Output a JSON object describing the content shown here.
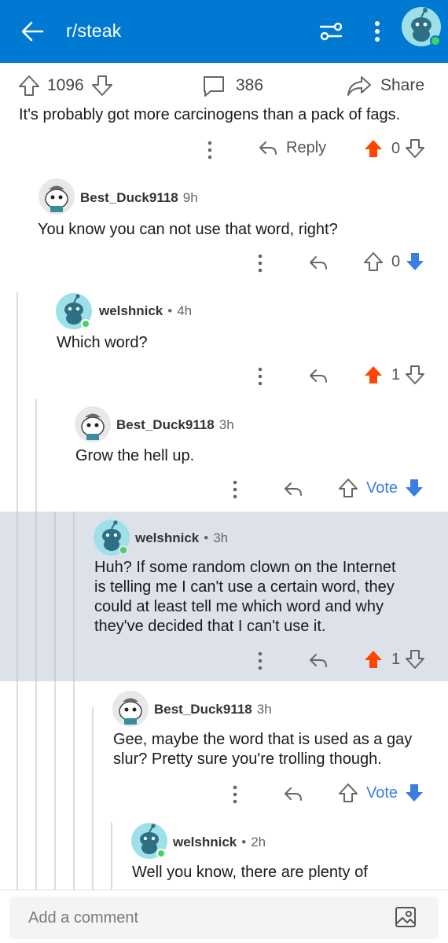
{
  "header": {
    "title": "r/steak",
    "back_icon": "back-arrow-icon",
    "sort_icon": "sort-options-icon",
    "more_icon": "more-vertical-icon",
    "avatar_icon": "snoo-avatar-icon"
  },
  "post": {
    "upvotes": "1096",
    "comments": "386",
    "share_label": "Share"
  },
  "comments": [
    {
      "text": "It's probably got more carcinogens than a pack of fags.",
      "reply_label": "Reply",
      "score": "0",
      "vote_state": "upvoted"
    },
    {
      "author": "Best_Duck9118",
      "time": "9h",
      "text": "You know you can not use that word, right?",
      "score": "0",
      "vote_state": "downvoted"
    },
    {
      "author": "welshnick",
      "time": "4h",
      "text": "Which word?",
      "score": "1",
      "vote_state": "upvoted"
    },
    {
      "author": "Best_Duck9118",
      "time": "3h",
      "text": "Grow the hell up.",
      "score": "Vote",
      "vote_state": "downvoted"
    },
    {
      "author": "welshnick",
      "time": "3h",
      "text": "Huh? If some random clown on the Internet is telling me I can't use a certain word, they could at least tell me which word and why they've decided that I can't use it.",
      "lines": [
        "Huh? If some random clown on the Internet",
        "is telling me I can't use a certain word, they",
        "could at least tell me which word and why",
        "they've decided that I can't use it."
      ],
      "score": "1",
      "vote_state": "upvoted"
    },
    {
      "author": "Best_Duck9118",
      "time": "3h",
      "lines": [
        "Gee, maybe the word that is used as a gay",
        "slur? Pretty sure you're trolling though."
      ],
      "score": "Vote",
      "vote_state": "downvoted"
    },
    {
      "author": "welshnick",
      "time": "2h",
      "text": "Well you know, there are plenty of"
    }
  ],
  "composer": {
    "placeholder": "Add a comment",
    "image_icon": "image-icon"
  },
  "colors": {
    "brand": "#0079d3",
    "upvote": "#ff4500",
    "downvote": "#3a7ee4",
    "highlight": "#dde2ea"
  }
}
